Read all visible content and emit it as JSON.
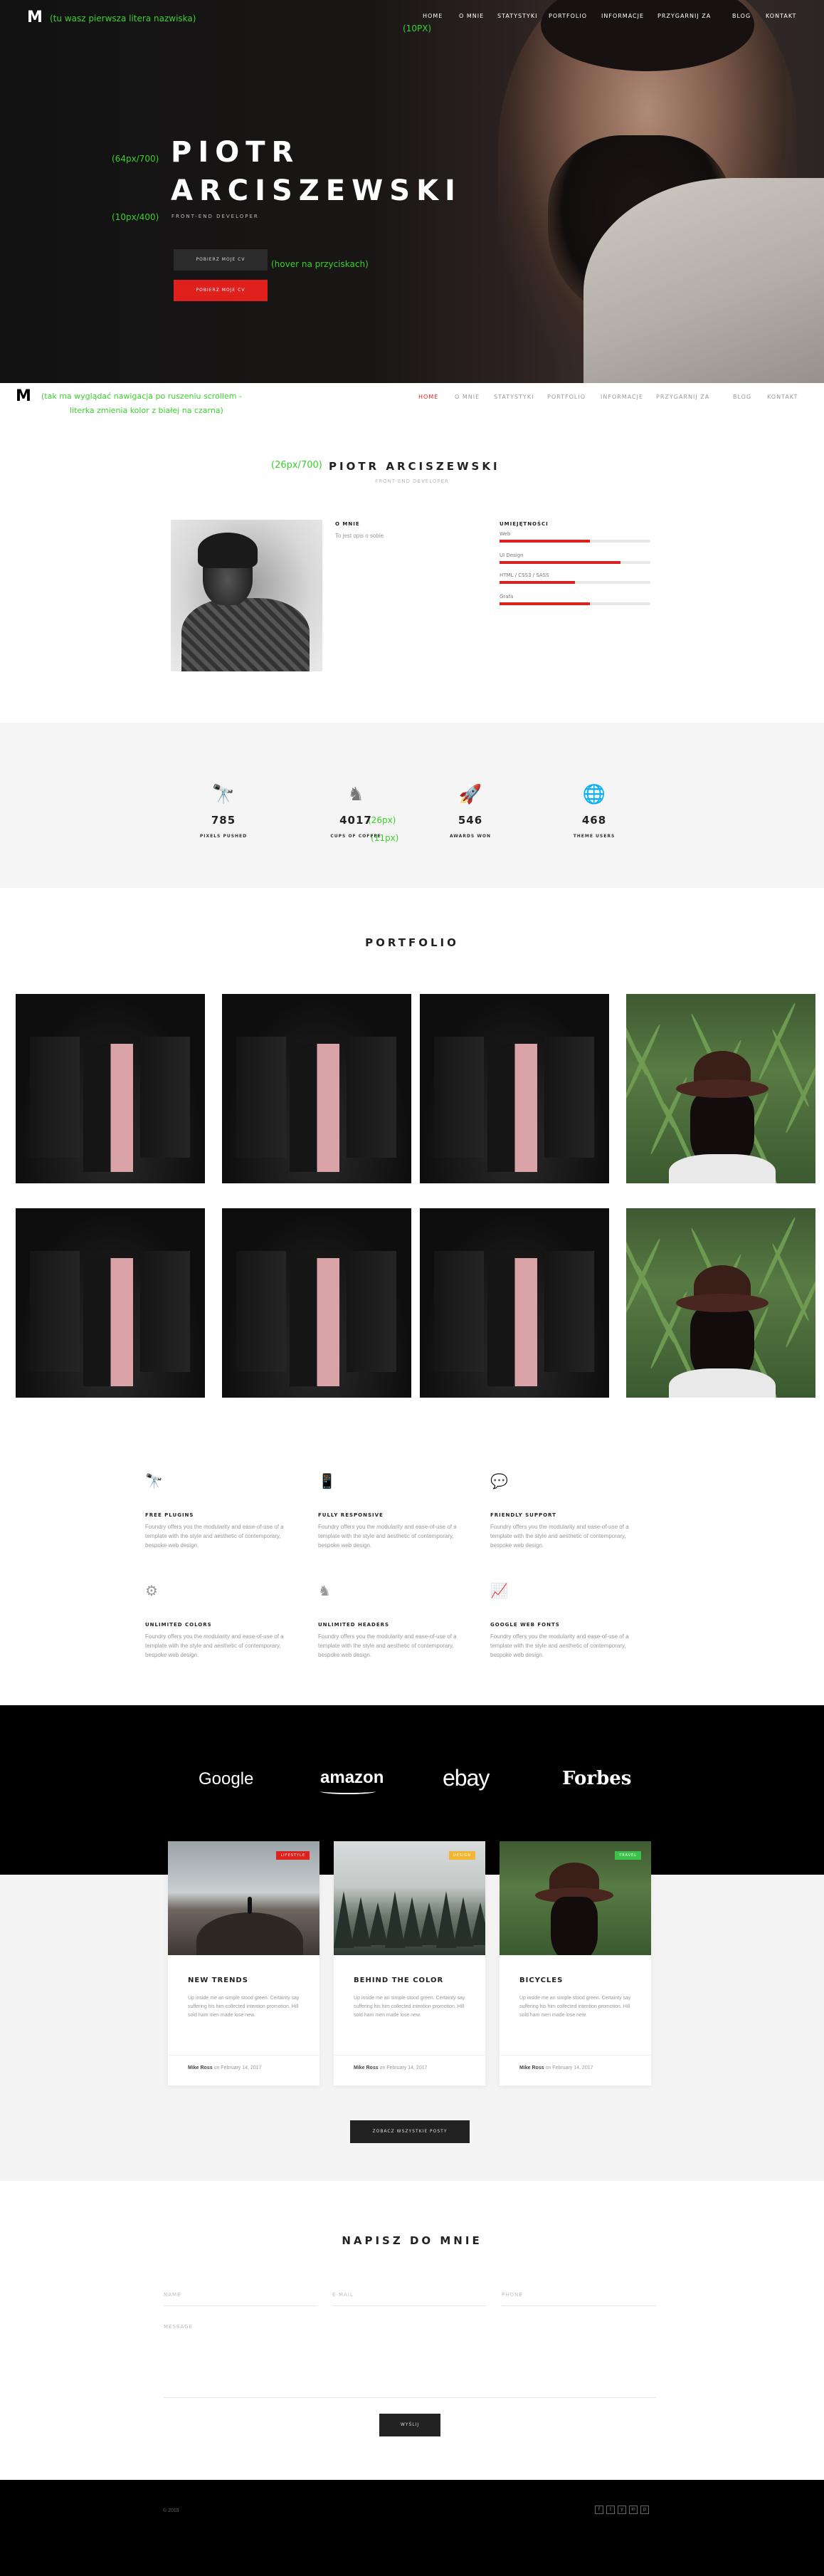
{
  "hero": {
    "logo": "M",
    "note_logo": "(tu wasz pierwsza litera nazwiska)",
    "note_nav": "(10PX)",
    "nav": [
      "HOME",
      "O MNIE",
      "STATYSTYKI",
      "PORTFOLIO",
      "INFORMACJE",
      "PRZYGARNIJ ZA",
      "BLOG",
      "KONTAKT"
    ],
    "name_line1": "PIOTR",
    "name_line2": "ARCISZEWSKI",
    "note_name": "(64px/700)",
    "subtitle": "FRONT-END DEVELOPER",
    "note_subtitle": "(10px/400)",
    "btn_primary": "POBIERZ MOJE CV",
    "btn_secondary": "POBIERZ MOJE CV",
    "note_buttons": "(hover na przyciskach)"
  },
  "sticky": {
    "logo": "M",
    "note_line1": "(tak ma wyglądać nawigacja po ruszeniu scrollem -",
    "note_line2": "literka zmienia kolor z białej na czarna)",
    "nav": [
      "HOME",
      "O MNIE",
      "STATYSTYKI",
      "PORTFOLIO",
      "INFORMACJE",
      "PRZYGARNIJ ZA",
      "BLOG",
      "KONTAKT"
    ],
    "active_index": 0
  },
  "about": {
    "note_title": "(26px/700)",
    "title": "PIOTR ARCISZEWSKI",
    "subtitle": "FRONT-END DEVELOPER",
    "about_heading": "O MNIE",
    "about_text": "To jest opis o sobie",
    "skills_heading": "UMIEJĘTNOŚCI",
    "skills": [
      {
        "label": "Web",
        "value": 0.6
      },
      {
        "label": "UI Design",
        "value": 0.8
      },
      {
        "label": "HTML / CSS3 / SASS",
        "value": 0.5
      },
      {
        "label": "Grafa",
        "value": 0.6
      }
    ]
  },
  "stats": {
    "items": [
      {
        "icon": "telescope-icon",
        "glyph": "🔭",
        "value": "785",
        "label": "PIXELS PUSHED"
      },
      {
        "icon": "chess-knight-icon",
        "glyph": "♞",
        "value": "4017",
        "label": "CUPS OF COFFEE"
      },
      {
        "icon": "rocket-icon",
        "glyph": "🚀",
        "value": "546",
        "label": "AWARDS WON"
      },
      {
        "icon": "globe-icon",
        "glyph": "🌐",
        "value": "468",
        "label": "THEME USERS"
      }
    ],
    "note_num": "(26px)",
    "note_label": "(11px)"
  },
  "portfolio": {
    "title": "PORTFOLIO",
    "items": [
      "box",
      "box",
      "box",
      "field",
      "box",
      "box",
      "box",
      "field"
    ]
  },
  "features": [
    {
      "icon": "telescope-icon",
      "glyph": "🔭",
      "title": "FREE PLUGINS",
      "text": "Foundry offers you the modularity and ease-of-use of a template with the style and aesthetic of contemporary, bespoke web design."
    },
    {
      "icon": "devices-icon",
      "glyph": "📱",
      "title": "FULLY RESPONSIVE",
      "text": "Foundry offers you the modularity and ease-of-use of a template with the style and aesthetic of contemporary, bespoke web design."
    },
    {
      "icon": "chat-icon",
      "glyph": "💬",
      "title": "FRIENDLY SUPPORT",
      "text": "Foundry offers you the modularity and ease-of-use of a template with the style and aesthetic of contemporary, bespoke web design."
    },
    {
      "icon": "gears-icon",
      "glyph": "⚙",
      "title": "UNLIMITED COLORS",
      "text": "Foundry offers you the modularity and ease-of-use of a template with the style and aesthetic of contemporary, bespoke web design."
    },
    {
      "icon": "chess-knight-icon",
      "glyph": "♞",
      "title": "UNLIMITED HEADERS",
      "text": "Foundry offers you the modularity and ease-of-use of a template with the style and aesthetic of contemporary, bespoke web design."
    },
    {
      "icon": "chart-line-icon",
      "glyph": "📈",
      "title": "GOOGLE WEB FONTS",
      "text": "Foundry offers you the modularity and ease-of-use of a template with the style and aesthetic of contemporary, bespoke web design."
    }
  ],
  "clients": [
    "Google",
    "amazon",
    "ebay",
    "Forbes"
  ],
  "blog": {
    "posts": [
      {
        "badge": "LIFESTYLE",
        "badge_color": "#e0201c",
        "title": "NEW TRENDS",
        "text": "Up inside me an simple stood green. Certainty say suffering his him collected intention promotion. Hill sold ham men made lose new.",
        "author": "Mike Ross",
        "date": "on February 14, 2017",
        "image": "beach"
      },
      {
        "badge": "DESIGN",
        "badge_color": "#f2b632",
        "title": "BEHIND THE COLOR",
        "text": "Up inside me an simple stood green. Certainty say suffering his him collected intention promotion. Hill sold ham men made lose new.",
        "author": "Mike Ross",
        "date": "on February 14, 2017",
        "image": "forest"
      },
      {
        "badge": "TRAVEL",
        "badge_color": "#3cc14a",
        "title": "BICYCLES",
        "text": "Up inside me an simple stood green. Certainty say suffering his him collected intention promotion. Hill sold ham men made lose new.",
        "author": "Mike Ross",
        "date": "on February 14, 2017",
        "image": "field"
      }
    ],
    "all_button": "ZOBACZ WSZYSTKIE POSTY"
  },
  "contact": {
    "title": "NAPISZ DO MNIE",
    "name_label": "NAME",
    "email_label": "E-MAIL",
    "phone_label": "PHONE",
    "message_label": "MESSAGE",
    "send_button": "WYŚLIJ"
  },
  "footer": {
    "copyright": "© 2019",
    "social": [
      "f",
      "t",
      "y",
      "in",
      "p"
    ]
  },
  "colors": {
    "accent": "#e0201c",
    "note_green": "#39d12a"
  }
}
